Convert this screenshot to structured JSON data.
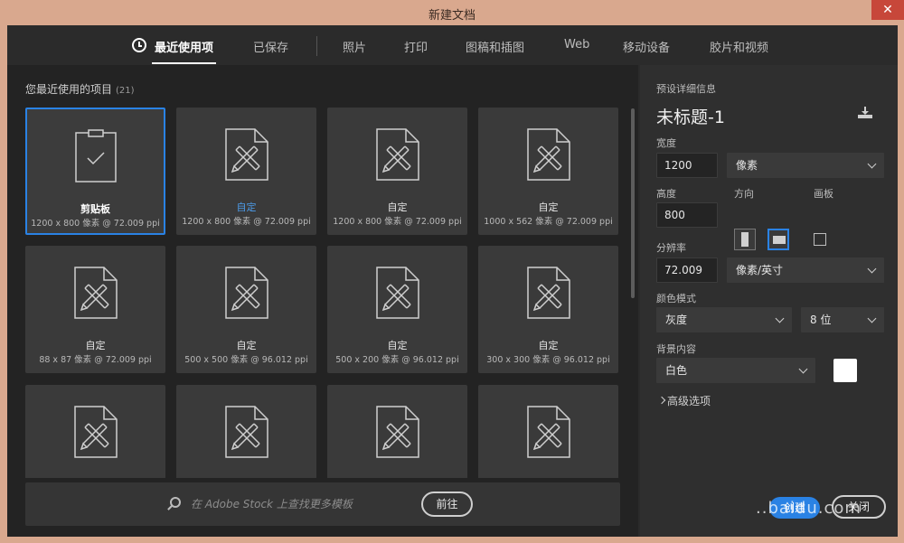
{
  "window": {
    "title": "新建文档",
    "close_glyph": "✕"
  },
  "tabs": [
    {
      "label": "最近使用项",
      "active": true
    },
    {
      "label": "已保存"
    },
    {
      "label": "照片"
    },
    {
      "label": "打印"
    },
    {
      "label": "图稿和插图"
    },
    {
      "label": "Web"
    },
    {
      "label": "移动设备"
    },
    {
      "label": "胶片和视频"
    }
  ],
  "recent": {
    "title": "您最近使用的项目",
    "count": "(21)",
    "items": [
      {
        "name": "剪贴板",
        "dims": "1200 x 800 像素 @ 72.009 ppi",
        "icon": "clipboard-icon"
      },
      {
        "name": "自定",
        "dims": "1200 x 800 像素 @ 72.009 ppi",
        "icon": "document-pencil-icon"
      },
      {
        "name": "自定",
        "dims": "1200 x 800 像素 @ 72.009 ppi",
        "icon": "document-pencil-icon"
      },
      {
        "name": "自定",
        "dims": "1000 x 562 像素 @ 72.009 ppi",
        "icon": "document-pencil-icon"
      },
      {
        "name": "自定",
        "dims": "88 x 87 像素 @ 72.009 ppi",
        "icon": "document-pencil-icon"
      },
      {
        "name": "自定",
        "dims": "500 x 500 像素 @ 96.012 ppi",
        "icon": "document-pencil-icon"
      },
      {
        "name": "自定",
        "dims": "500 x 200 像素 @ 96.012 ppi",
        "icon": "document-pencil-icon"
      },
      {
        "name": "自定",
        "dims": "300 x 300 像素 @ 96.012 ppi",
        "icon": "document-pencil-icon"
      },
      {
        "name": "",
        "dims": "",
        "icon": "document-pencil-icon"
      },
      {
        "name": "",
        "dims": "",
        "icon": "document-pencil-icon"
      },
      {
        "name": "",
        "dims": "",
        "icon": "document-pencil-icon"
      },
      {
        "name": "",
        "dims": "",
        "icon": "document-pencil-icon"
      }
    ]
  },
  "search": {
    "placeholder": "在 Adobe Stock 上查找更多模板",
    "go_label": "前往"
  },
  "preset": {
    "section_label": "预设详细信息",
    "doc_title": "未标题-1",
    "width_label": "宽度",
    "width_value": "1200",
    "width_unit": "像素",
    "height_label": "高度",
    "height_value": "800",
    "orientation_label": "方向",
    "artboard_label": "画板",
    "resolution_label": "分辨率",
    "resolution_value": "72.009",
    "resolution_unit": "像素/英寸",
    "color_mode_label": "颜色模式",
    "color_mode_value": "灰度",
    "bit_depth_value": "8 位",
    "background_label": "背景内容",
    "background_value": "白色",
    "background_color": "#ffffff",
    "advanced_label": "高级选项"
  },
  "actions": {
    "create_label": "创建",
    "close_label": "关闭"
  },
  "watermark": "..baidu.com",
  "colors": {
    "accent": "#2a82e4",
    "panel": "#2f2f2f",
    "card": "#3a3a3a"
  }
}
